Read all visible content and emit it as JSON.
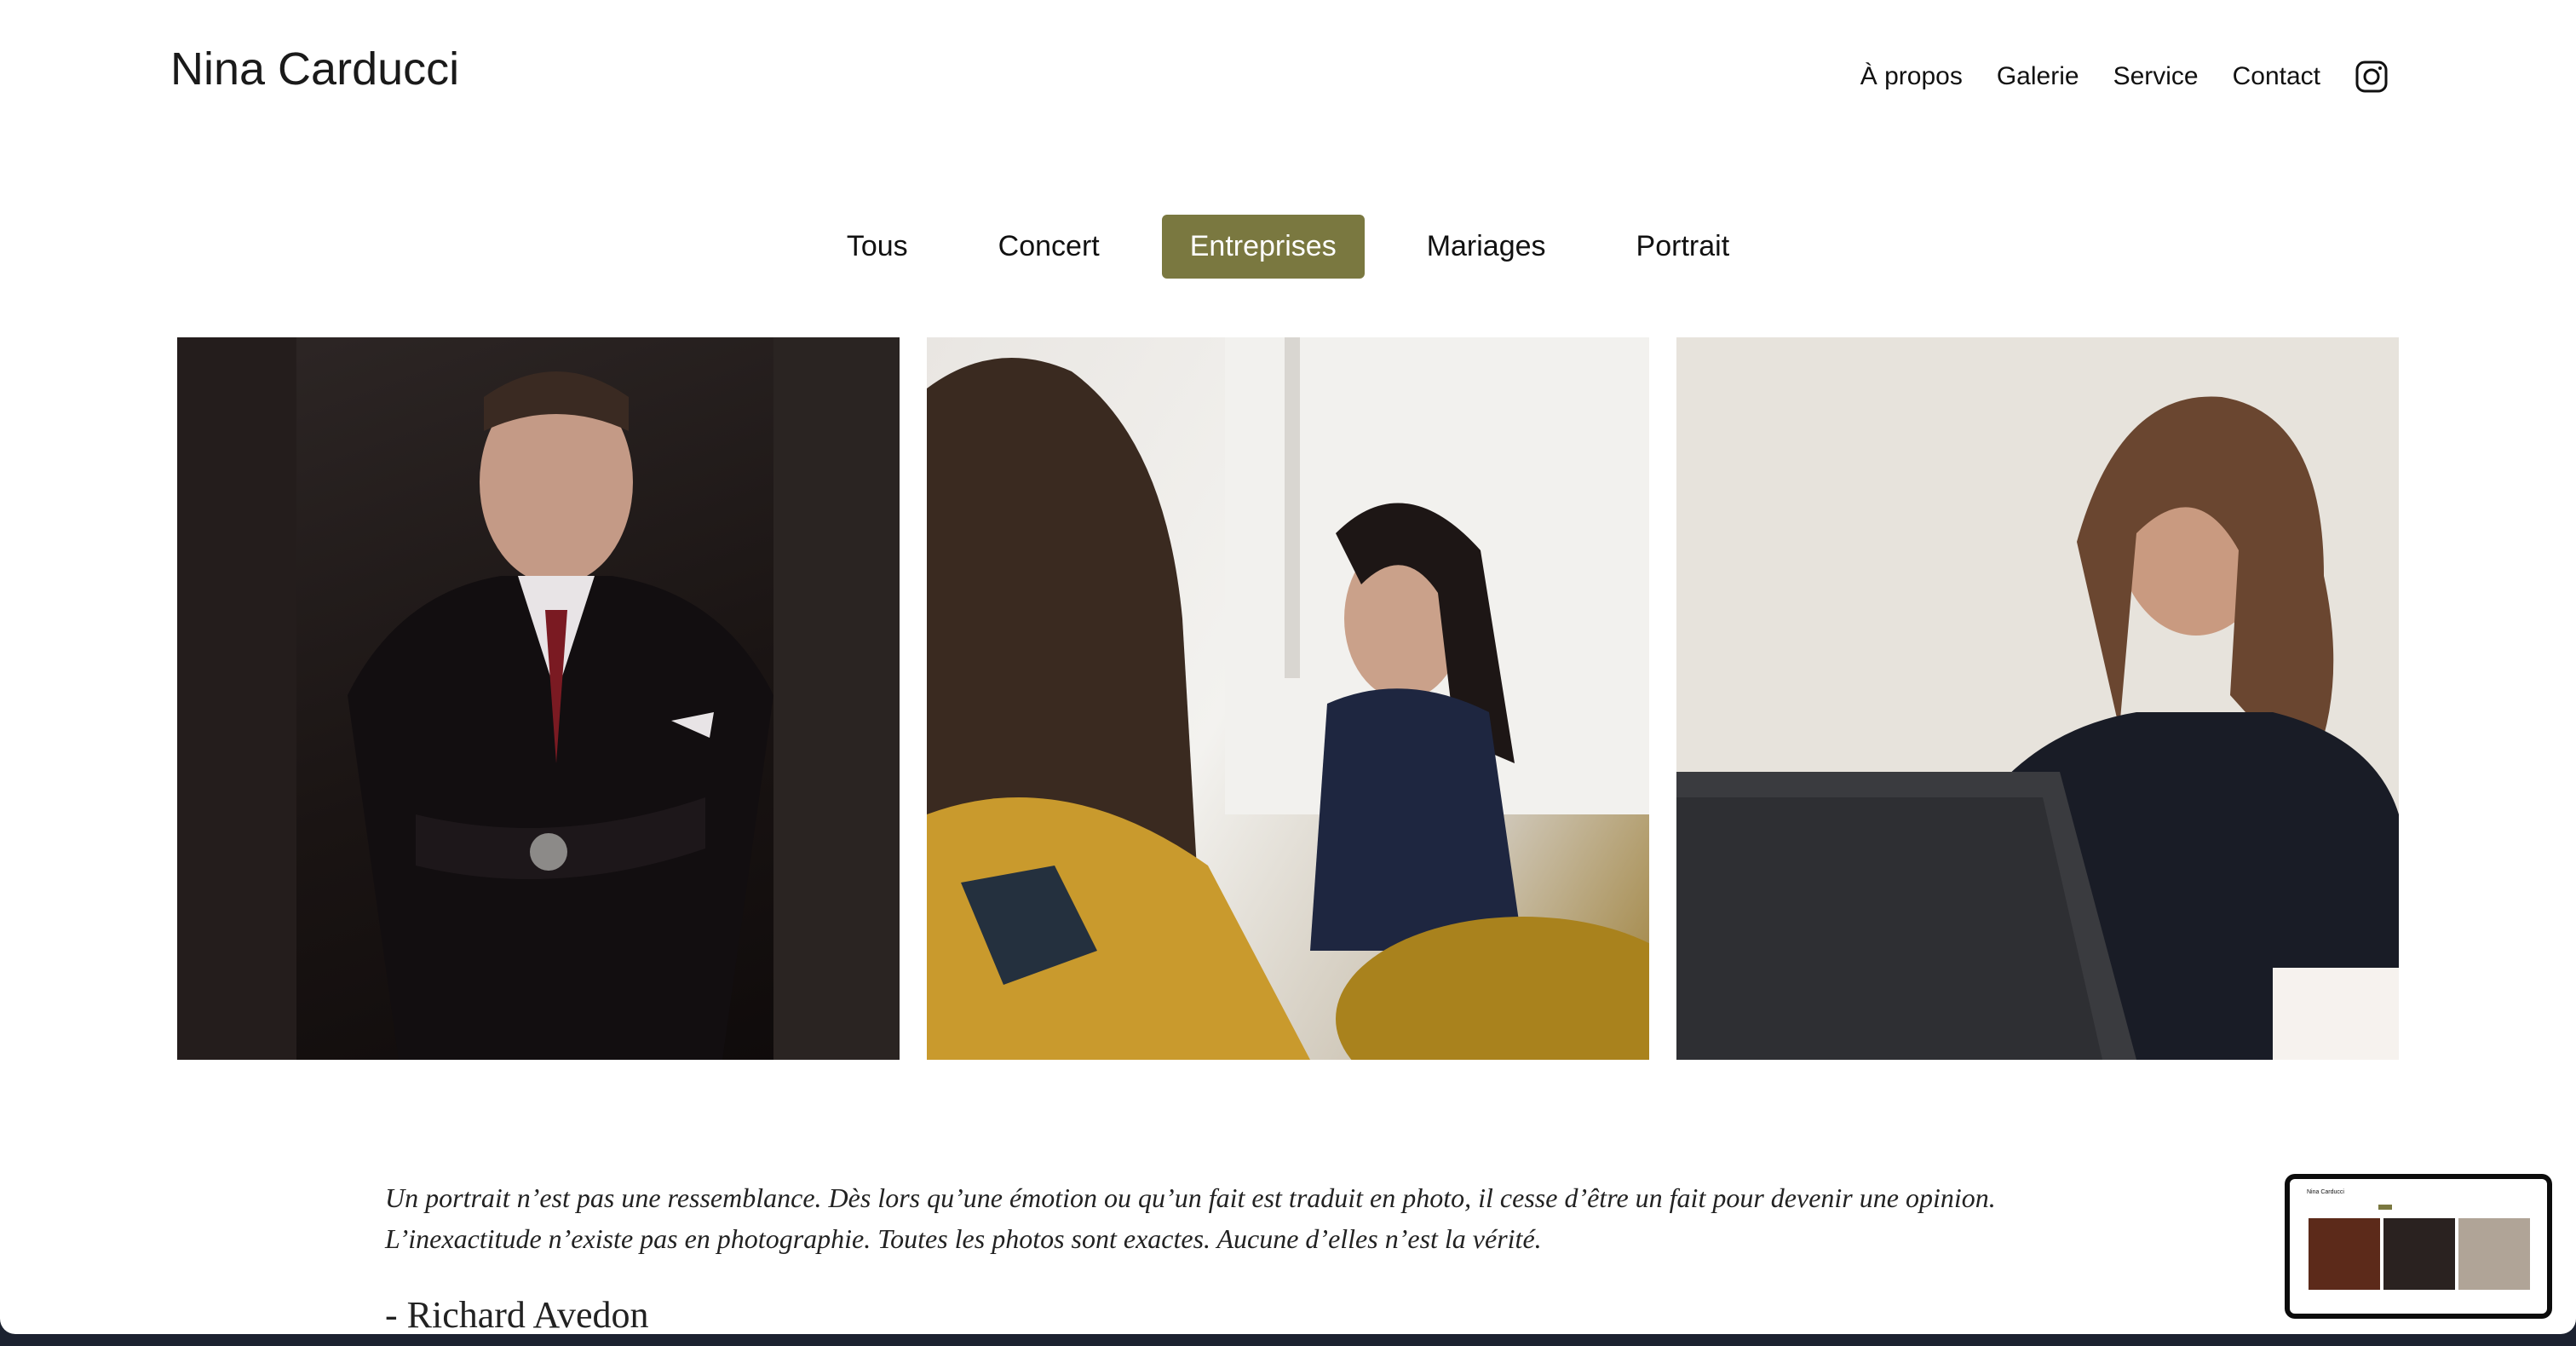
{
  "site": {
    "logo": "Nina Carducci",
    "nav": [
      "À propos",
      "Galerie",
      "Service",
      "Contact"
    ],
    "instagram_icon": "instagram-icon"
  },
  "filters": {
    "items": [
      "Tous",
      "Concert",
      "Entreprises",
      "Mariages",
      "Portrait"
    ],
    "active": "Entreprises",
    "active_color": "#7a7840"
  },
  "gallery": {
    "photos": [
      {
        "label": "businessman-in-suit-photo"
      },
      {
        "label": "smiling-woman-in-meeting-photo"
      },
      {
        "label": "laughing-woman-with-laptop-photo"
      }
    ]
  },
  "quote": {
    "text": "Un portrait n’est pas une ressemblance. Dès lors qu’une émotion ou qu’un fait est traduit en photo, il cesse d’être un fait pour devenir une opinion. L’inexactitude n’existe pas en photographie. Toutes les photos sont exactes. Aucune d’elles n’est la vérité.",
    "author": "- Richard Avedon"
  },
  "thumbnail": {
    "title": "Nina Carducci"
  }
}
